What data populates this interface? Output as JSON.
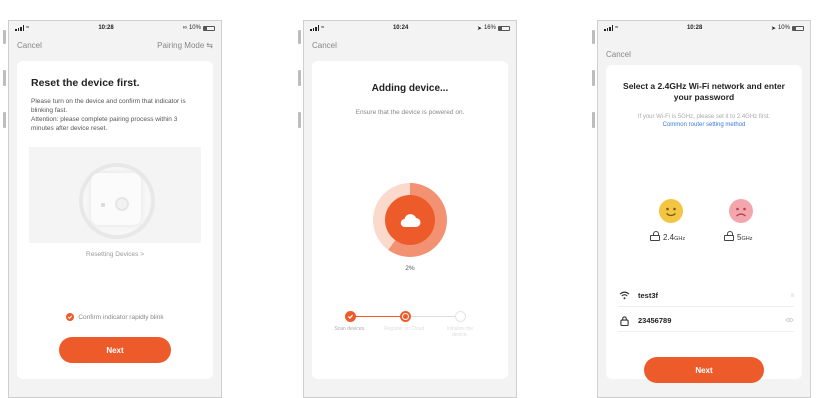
{
  "colors": {
    "accent": "#ee5b2a",
    "link": "#3a7bd5",
    "card": "#ffffff",
    "background": "#f3f3f3"
  },
  "screen1": {
    "status": {
      "time": "10:28",
      "battery": "10%"
    },
    "nav": {
      "cancel": "Cancel",
      "pairing_mode": "Pairing Mode"
    },
    "title": "Reset the device first.",
    "desc_line1": "Please turn on the device and confirm that indicator is blinking fast.",
    "desc_line2": "Attention: please complete pairing process within 3 minutes after device reset.",
    "resetting_link": "Resetting Devices >",
    "confirm_label": "Confirm indicator rapidly blink",
    "next": "Next"
  },
  "screen2": {
    "status": {
      "time": "10:24",
      "battery": "16%"
    },
    "nav": {
      "cancel": "Cancel"
    },
    "title": "Adding device...",
    "subtitle": "Ensure that the device is powered on.",
    "progress_text": "2%",
    "progress_fraction": 0.6,
    "steps": [
      {
        "label": "Scan devices.",
        "state": "done"
      },
      {
        "label": "Register on Cloud.",
        "state": "active"
      },
      {
        "label": "Initialize the device.",
        "state": "pending"
      }
    ]
  },
  "screen3": {
    "status": {
      "time": "10:28",
      "battery": "10%"
    },
    "nav": {
      "cancel": "Cancel"
    },
    "title": "Select a 2.4GHz Wi-Fi network and enter your password",
    "hint": "If your Wi-Fi is 5GHz, please set it to 2.4GHz first.",
    "hint_link": "Common router setting method",
    "band_24": {
      "label": "2.4",
      "unit": "GHz"
    },
    "band_5": {
      "label": "5",
      "unit": "GHz"
    },
    "wifi_name": "test3f",
    "wifi_tail": "≡",
    "password": "23456789",
    "next": "Next"
  }
}
